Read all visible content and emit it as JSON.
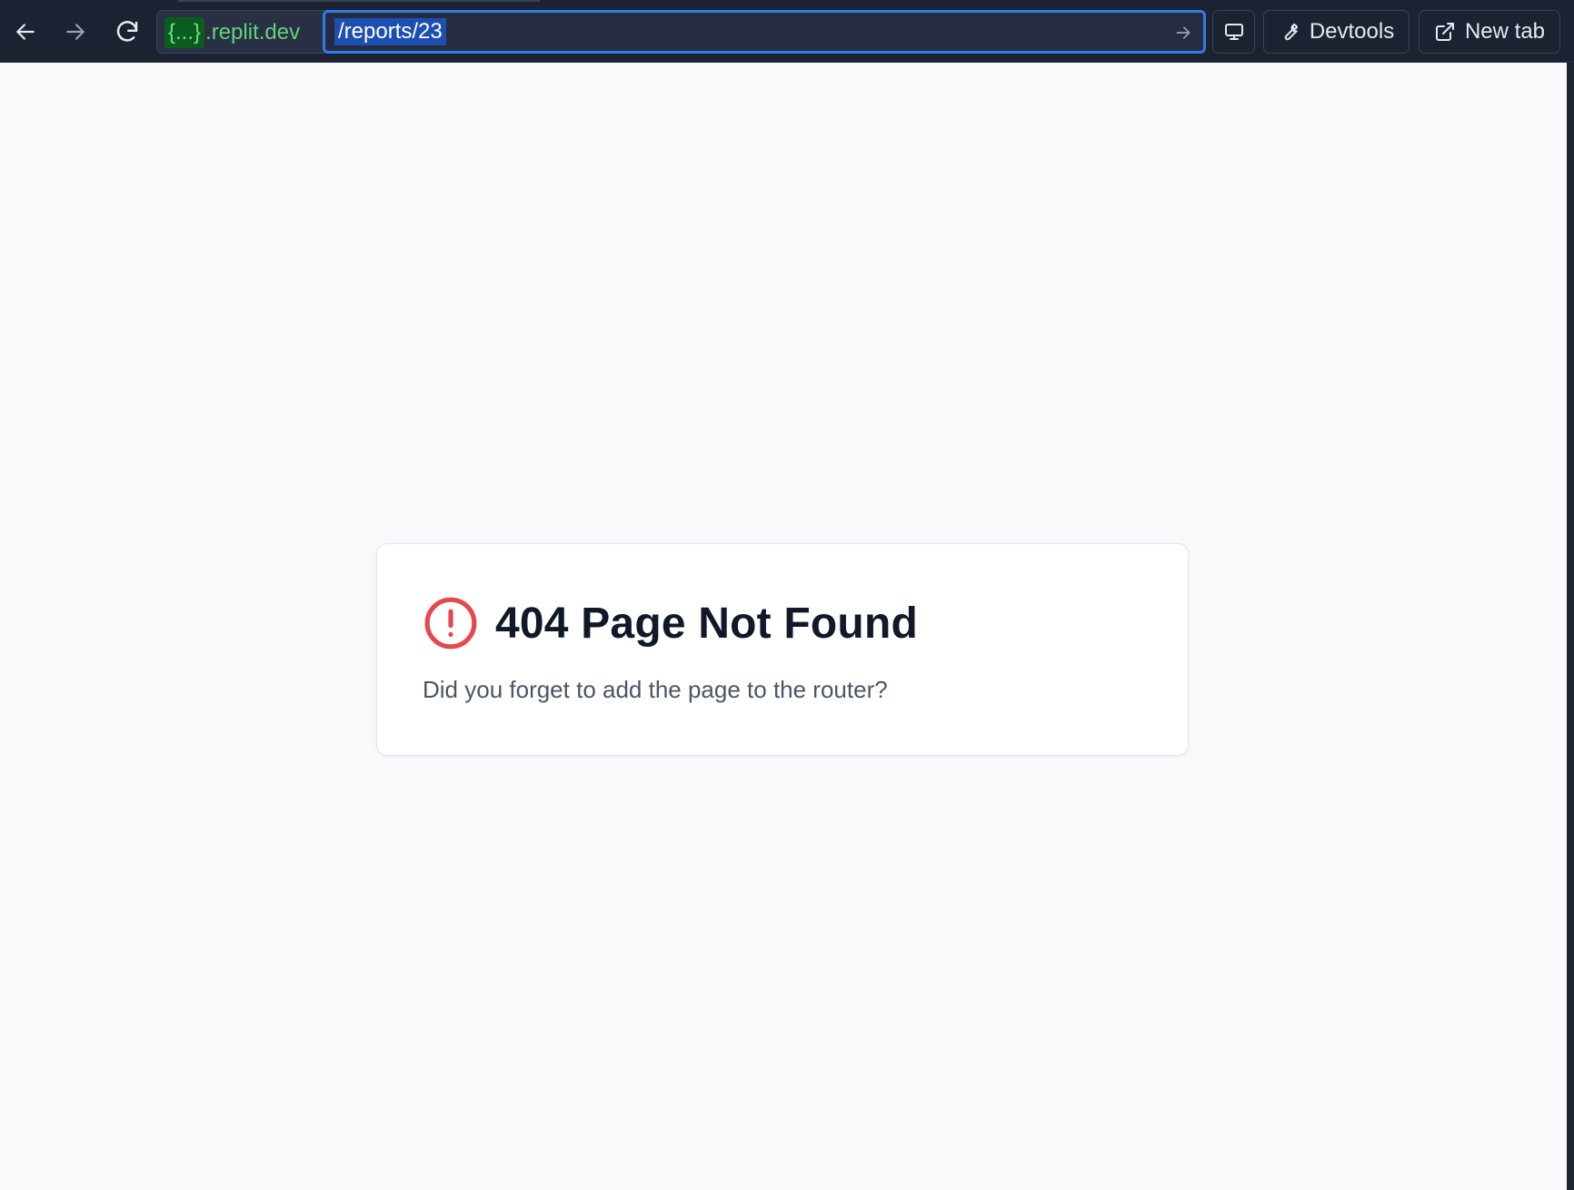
{
  "browser": {
    "url": {
      "dev_badge": "{...}",
      "host": ".replit.dev",
      "path": "/reports/23"
    },
    "nav": {
      "back_icon": "arrow-left-icon",
      "forward_icon": "arrow-right-icon",
      "reload_icon": "reload-icon",
      "go_icon": "arrow-right-icon"
    },
    "tools": {
      "screen_icon": "monitor-icon",
      "devtools_label": "Devtools",
      "devtools_icon": "wrench-icon",
      "newtab_label": "New tab",
      "newtab_icon": "external-link-icon"
    },
    "colors": {
      "toolbar_bg": "#1c2232",
      "url_focus": "#2f7ae5",
      "host_green": "#5fd37a"
    }
  },
  "page": {
    "title": "404 Page Not Found",
    "description": "Did you forget to add the page to the router?",
    "icon": "alert-circle-icon",
    "icon_color": "#e5484d",
    "background": "#f8f9fb"
  }
}
